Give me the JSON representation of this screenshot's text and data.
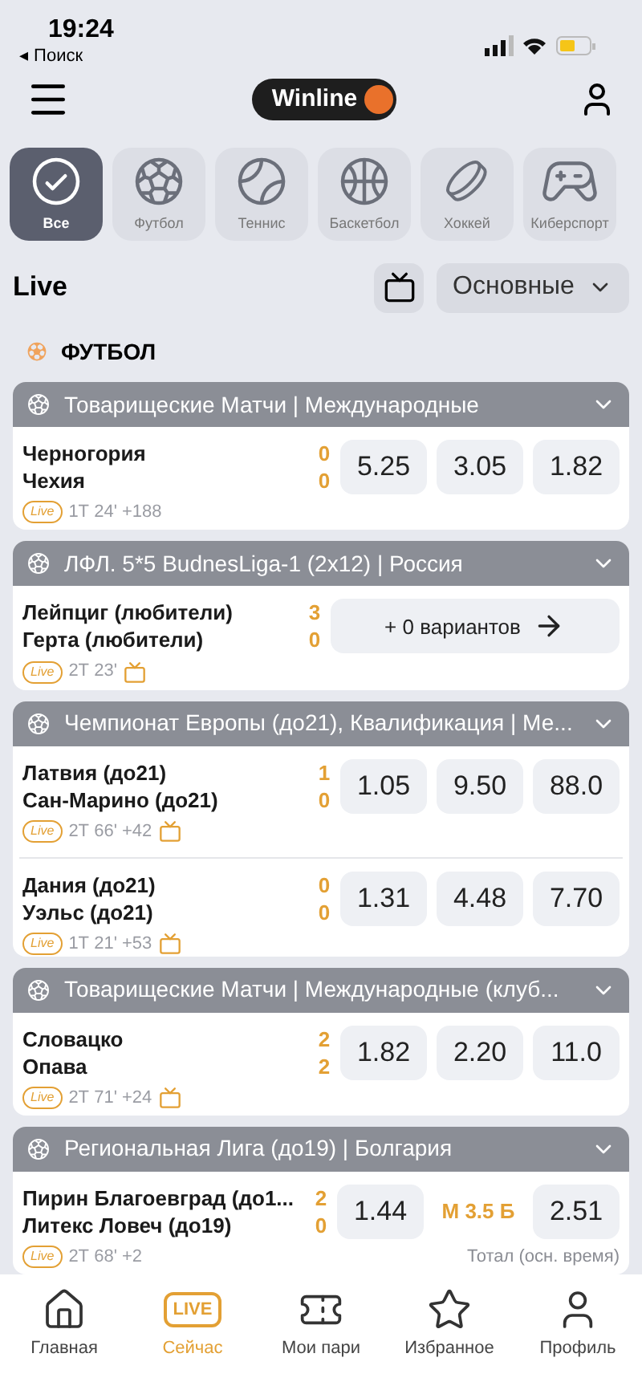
{
  "status_bar": {
    "time": "19:24",
    "back": "◂ Поиск"
  },
  "header": {
    "logo": "Winline"
  },
  "sports": [
    {
      "kind": "all",
      "label": "Все",
      "selected": true
    },
    {
      "kind": "football",
      "label": "Футбол",
      "selected": false
    },
    {
      "kind": "tennis",
      "label": "Теннис",
      "selected": false
    },
    {
      "kind": "basketball",
      "label": "Баскетбол",
      "selected": false
    },
    {
      "kind": "hockey",
      "label": "Хоккей",
      "selected": false
    },
    {
      "kind": "esports",
      "label": "Киберспорт",
      "selected": false
    }
  ],
  "live_bar": {
    "title": "Live",
    "filter": "Основные"
  },
  "section": {
    "title": "ФУТБОЛ"
  },
  "leagues": [
    {
      "title": "Товарищеские Матчи | Международные",
      "matches": [
        {
          "kind": "odds",
          "team1": "Черногория",
          "team2": "Чехия",
          "score1": "0",
          "score2": "0",
          "badge": "Live",
          "time": "1Т 24' +188",
          "tv": false,
          "odds": [
            "5.25",
            "3.05",
            "1.82"
          ]
        }
      ]
    },
    {
      "title": "ЛФЛ. 5*5 BudnesLiga-1 (2x12) | Россия",
      "matches": [
        {
          "kind": "more",
          "team1": "Лейпциг (любители)",
          "team2": "Герта (любители)",
          "score1": "3",
          "score2": "0",
          "badge": "Live",
          "time": "2Т 23'",
          "tv": true,
          "more": "+ 0 вариантов"
        }
      ]
    },
    {
      "title": "Чемпионат Европы (до21), Квалификация | Ме...",
      "matches": [
        {
          "kind": "odds",
          "team1": "Латвия (до21)",
          "team2": "Сан-Марино (до21)",
          "score1": "1",
          "score2": "0",
          "badge": "Live",
          "time": "2Т 66' +42",
          "tv": true,
          "odds": [
            "1.05",
            "9.50",
            "88.0"
          ]
        },
        {
          "kind": "odds",
          "team1": "Дания (до21)",
          "team2": "Уэльс (до21)",
          "score1": "0",
          "score2": "0",
          "badge": "Live",
          "time": "1Т 21' +53",
          "tv": true,
          "odds": [
            "1.31",
            "4.48",
            "7.70"
          ]
        }
      ]
    },
    {
      "title": "Товарищеские Матчи | Международные (клуб...",
      "matches": [
        {
          "kind": "odds",
          "team1": "Словацко",
          "team2": "Опава",
          "score1": "2",
          "score2": "2",
          "badge": "Live",
          "time": "2Т 71' +24",
          "tv": true,
          "odds": [
            "1.82",
            "2.20",
            "11.0"
          ]
        }
      ]
    },
    {
      "title": "Региональная Лига (до19) | Болгария",
      "matches": [
        {
          "kind": "total",
          "team1": "Пирин Благоевград (до1...",
          "team2": "Литекс Ловеч (до19)",
          "score1": "2",
          "score2": "0",
          "badge": "Live",
          "time": "2Т 68' +2",
          "tv": false,
          "odds": [
            "1.44",
            "2.51"
          ],
          "total": "М 3.5 Б",
          "note": "Тотал (осн. время)"
        }
      ]
    }
  ],
  "bottom_nav": [
    {
      "kind": "home",
      "label": "Главная",
      "selected": false
    },
    {
      "kind": "live",
      "label": "Сейчас",
      "icon_text": "LIVE",
      "selected": true
    },
    {
      "kind": "ticket",
      "label": "Мои пари",
      "selected": false
    },
    {
      "kind": "star",
      "label": "Избранное",
      "selected": false
    },
    {
      "kind": "profile",
      "label": "Профиль",
      "selected": false
    }
  ]
}
